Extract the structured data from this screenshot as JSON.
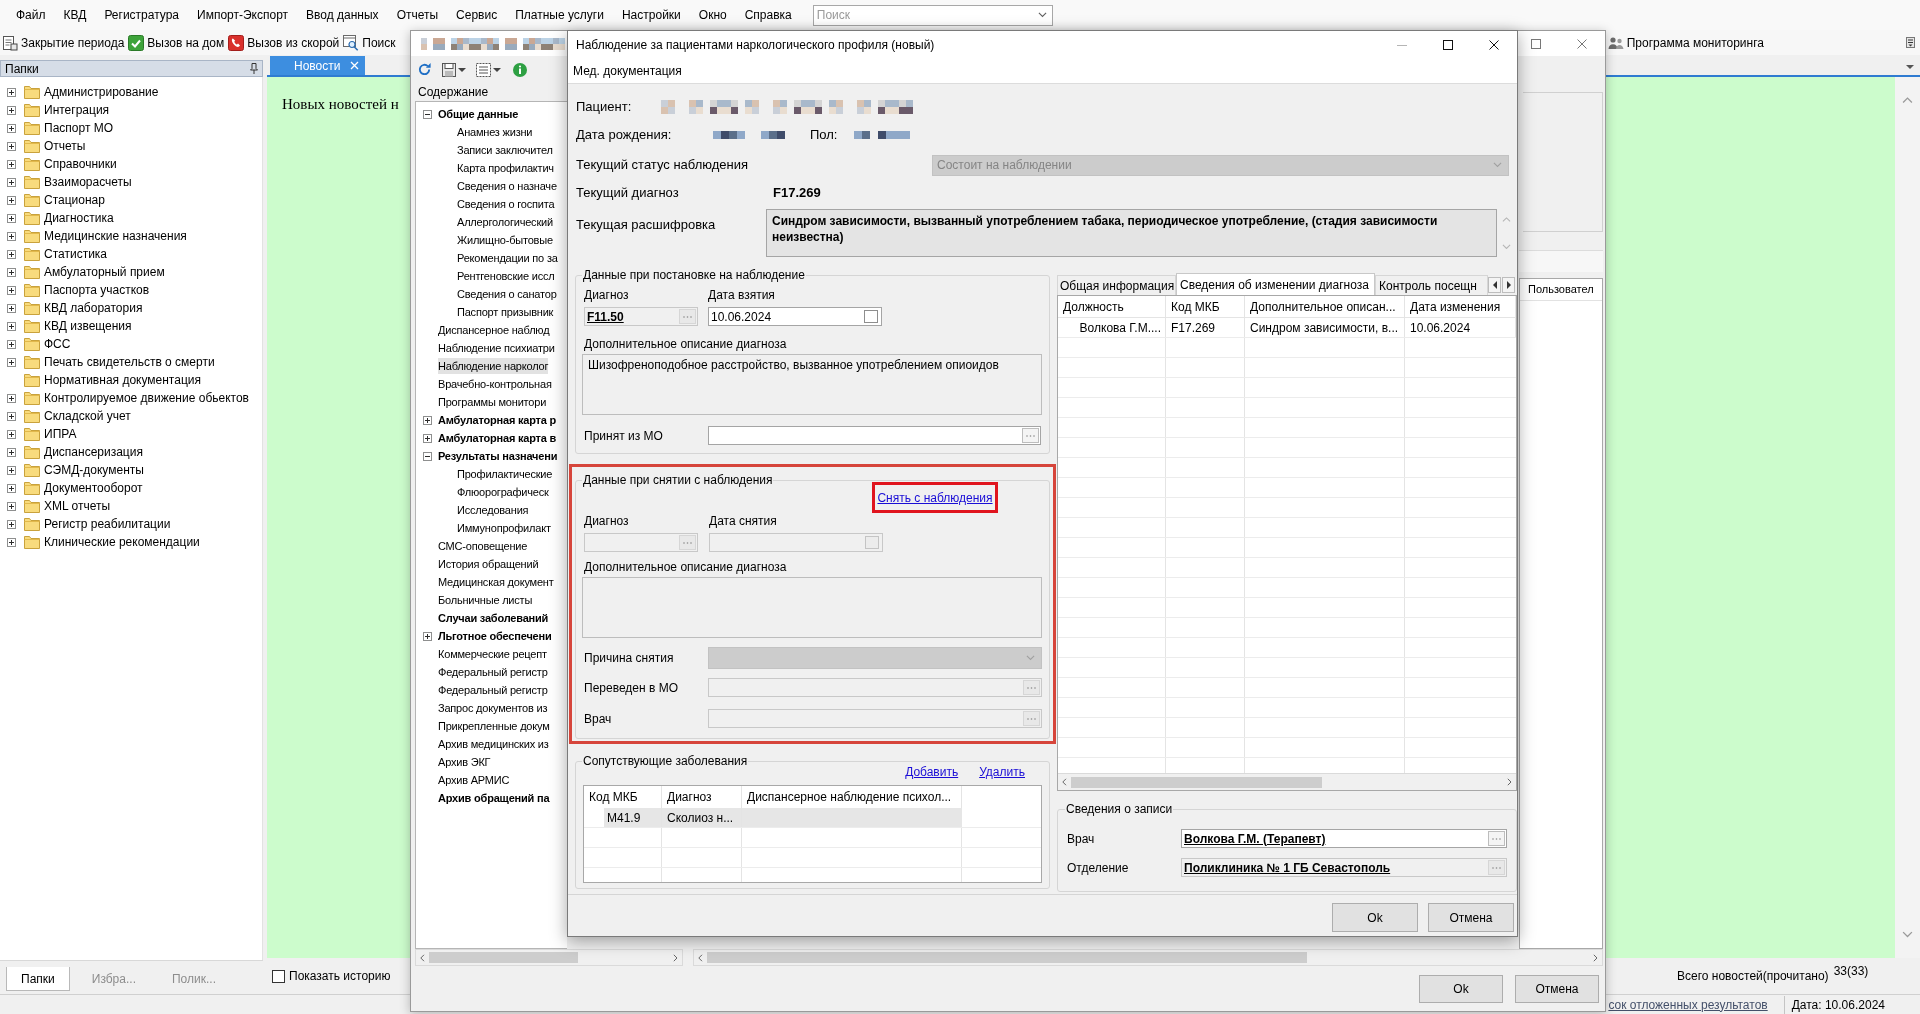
{
  "menu": [
    "Файл",
    "КВД",
    "Регистратура",
    "Импорт-Экспорт",
    "Ввод данных",
    "Отчеты",
    "Сервис",
    "Платные услуги",
    "Настройки",
    "Окно",
    "Справка"
  ],
  "search": {
    "placeholder": "Поиск"
  },
  "toolbar": [
    "Закрытие периода",
    "Вызов на дом",
    "Вызов из скорой",
    "Поиск"
  ],
  "toolbar_right": [
    "Программа мониторинга"
  ],
  "folders_panel": {
    "title": "Папки",
    "items": [
      {
        "label": "Администрирование",
        "expandable": true
      },
      {
        "label": "Интеграция",
        "expandable": true
      },
      {
        "label": "Паспорт МО",
        "expandable": true
      },
      {
        "label": "Отчеты",
        "expandable": true
      },
      {
        "label": "Справочники",
        "expandable": true
      },
      {
        "label": "Взаиморасчеты",
        "expandable": true
      },
      {
        "label": "Стационар",
        "expandable": true
      },
      {
        "label": "Диагностика",
        "expandable": true
      },
      {
        "label": "Медицинские назначения",
        "expandable": true
      },
      {
        "label": "Статистика",
        "expandable": true
      },
      {
        "label": "Амбулаторный прием",
        "expandable": true
      },
      {
        "label": "Паспорта участков",
        "expandable": true
      },
      {
        "label": "КВД лаборатория",
        "expandable": true
      },
      {
        "label": "КВД извещения",
        "expandable": true
      },
      {
        "label": "ФСС",
        "expandable": true
      },
      {
        "label": "Печать свидетельств о смерти",
        "expandable": true
      },
      {
        "label": "Нормативная документация",
        "expandable": false
      },
      {
        "label": "Контролируемое движение обьектов",
        "expandable": true
      },
      {
        "label": "Складской учет",
        "expandable": true
      },
      {
        "label": "ИПРА",
        "expandable": true
      },
      {
        "label": "Диспансеризация",
        "expandable": true
      },
      {
        "label": "СЭМД-документы",
        "expandable": true
      },
      {
        "label": "Документооборот",
        "expandable": true
      },
      {
        "label": "XML отчеты",
        "expandable": true
      },
      {
        "label": "Регистр реабилитации",
        "expandable": true
      },
      {
        "label": "Клинические рекомендации",
        "expandable": true
      }
    ],
    "tabs": [
      {
        "label": "Папки",
        "selected": true
      },
      {
        "label": "Избра...",
        "selected": false
      },
      {
        "label": "Полик...",
        "selected": false
      }
    ]
  },
  "news": {
    "tab": "Новости",
    "message": "Новых новостей н",
    "show_history": {
      "label": "Показать историю",
      "checked": false
    },
    "total_label": "Всего новостей(прочитано)",
    "total_count": "33(33)"
  },
  "status_bar": {
    "link": "сок отложенных результатов",
    "date": "Дата: 10.06.2024"
  },
  "document_window": {
    "contents_title": "Содержание",
    "tree": [
      {
        "label": "Общие данные",
        "bold": true,
        "expanded": true,
        "selected": false,
        "children": [
          {
            "label": "Анамнез жизни",
            "bold": false,
            "selected": false
          },
          {
            "label": "Записи заключител",
            "bold": false,
            "selected": false
          },
          {
            "label": "Карта профилактич",
            "bold": false,
            "selected": false
          },
          {
            "label": "Сведения о назначе",
            "bold": false,
            "selected": false
          },
          {
            "label": "Сведения о госпита",
            "bold": false,
            "selected": false
          },
          {
            "label": "Аллергологический",
            "bold": false,
            "selected": false
          },
          {
            "label": "Жилищно-бытовые",
            "bold": false,
            "selected": false
          },
          {
            "label": "Рекомендации по за",
            "bold": false,
            "selected": false
          },
          {
            "label": "Рентгеновские иссл",
            "bold": false,
            "selected": false
          },
          {
            "label": "Сведения о санатор",
            "bold": false,
            "selected": false
          },
          {
            "label": "Паспорт призывник",
            "bold": false,
            "selected": false
          }
        ]
      },
      {
        "label": "Диспансерное наблюд",
        "bold": false,
        "selected": false
      },
      {
        "label": "Наблюдение психиатри",
        "bold": false,
        "selected": false
      },
      {
        "label": "Наблюдение нарколог",
        "bold": false,
        "selected": true
      },
      {
        "label": "Врачебно-контрольная",
        "bold": false,
        "selected": false
      },
      {
        "label": "Программы монитори",
        "bold": false,
        "selected": false
      },
      {
        "label": "Амбулаторная карта р",
        "bold": true,
        "expanded": false,
        "selected": false
      },
      {
        "label": "Амбулаторная карта в",
        "bold": true,
        "expanded": false,
        "selected": false
      },
      {
        "label": "Результаты назначени",
        "bold": true,
        "expanded": true,
        "selected": false,
        "children": [
          {
            "label": "Профилактические",
            "bold": false,
            "selected": false
          },
          {
            "label": "Флюорографическ",
            "bold": false,
            "selected": false
          },
          {
            "label": "Исследования",
            "bold": false,
            "selected": false
          },
          {
            "label": "Иммунопрофилакт",
            "bold": false,
            "selected": false
          }
        ]
      },
      {
        "label": "СМС-оповещение",
        "bold": false,
        "selected": false
      },
      {
        "label": "История обращений",
        "bold": false,
        "selected": false
      },
      {
        "label": "Медицинская документ",
        "bold": false,
        "selected": false
      },
      {
        "label": "Больничные листы",
        "bold": false,
        "selected": false
      },
      {
        "label": "Случаи заболеваний",
        "bold": true,
        "selected": false
      },
      {
        "label": "Льготное обеспечени",
        "bold": true,
        "expanded": false,
        "selected": false
      },
      {
        "label": "Коммерческие рецепт",
        "bold": false,
        "selected": false
      },
      {
        "label": "Федеральный регистр",
        "bold": false,
        "selected": false
      },
      {
        "label": "Федеральный регистр",
        "bold": false,
        "selected": false
      },
      {
        "label": "Запрос документов из",
        "bold": false,
        "selected": false
      },
      {
        "label": "Прикрепленные докум",
        "bold": false,
        "selected": false
      },
      {
        "label": "Архив медицинских из",
        "bold": false,
        "selected": false
      },
      {
        "label": "Архив ЭКГ",
        "bold": false,
        "selected": false
      },
      {
        "label": "Архив АРМИС",
        "bold": false,
        "selected": false
      },
      {
        "label": "Архив обращений па",
        "bold": true,
        "selected": false
      }
    ],
    "grid_column": "Пользовател",
    "buttons": [
      "Ok",
      "Отмена"
    ]
  },
  "dialog": {
    "title": "Наблюдение за пациентами наркологического профиля (новый)",
    "menu": [
      "Мед. документация"
    ],
    "patient": {
      "label": "Пациент:"
    },
    "birth_date": {
      "label": "Дата рождения:"
    },
    "sex": {
      "label": "Пол:"
    },
    "status": {
      "label": "Текущий статус наблюдения",
      "value": "Состоит на наблюдении",
      "disabled": true
    },
    "current_diagnosis": {
      "label": "Текущий диагноз",
      "value": "F17.269"
    },
    "decoding": {
      "label": "Текущая расшифровка",
      "value": "Синдром зависимости, вызванный употреблением табака, периодическое употребление, (стадия зависимости неизвестна)"
    },
    "registration": {
      "title": "Данные при постановке на наблюдение",
      "diagnosis": {
        "label": "Диагноз",
        "value": "F11.50",
        "disabled": true
      },
      "date": {
        "label": "Дата взятия",
        "value": "10.06.2024",
        "disabled": false
      },
      "description": {
        "label": "Дополнительное описание диагноза",
        "value": "Шизофреноподобное расстройство, вызванное употреблением опиоидов"
      },
      "source_mo": {
        "label": "Принят из МО",
        "disabled": false
      }
    },
    "deregistration": {
      "title": "Данные при снятии с наблюдения",
      "highlighted": true,
      "action": {
        "label": "Снять с наблюдения",
        "highlighted": true
      },
      "diagnosis": {
        "label": "Диагноз",
        "disabled": true
      },
      "date": {
        "label": "Дата снятия",
        "disabled": true
      },
      "description": {
        "label": "Дополнительное описание диагноза"
      },
      "reason": {
        "label": "Причина снятия",
        "disabled": true
      },
      "transferred_mo": {
        "label": "Переведен в МО",
        "disabled": true
      },
      "doctor": {
        "label": "Врач",
        "disabled": true
      }
    },
    "comorbidities": {
      "title": "Сопутствующие заболевания",
      "actions": [
        "Добавить",
        "Удалить"
      ],
      "columns": [
        "Код МКБ",
        "Диагноз",
        "Диспансерное наблюдение психол..."
      ],
      "rows": [
        {
          "cells": [
            "M41.9",
            "Сколиоз н..."
          ],
          "selected": true
        }
      ]
    },
    "tabs": [
      {
        "label": "Общая информация",
        "selected": false
      },
      {
        "label": "Сведения об изменении диагноза",
        "selected": true
      },
      {
        "label": "Контроль посещн",
        "selected": false
      }
    ],
    "history": {
      "columns": [
        "Должность",
        "Код МКБ",
        "Дополнительное описан...",
        "Дата изменения"
      ],
      "rows": [
        [
          "Волкова Г.М....",
          "F17.269",
          "Синдром зависимости, в...",
          "10.06.2024"
        ]
      ]
    },
    "record": {
      "title": "Сведения о записи",
      "doctor": {
        "label": "Врач",
        "value": "Волкова Г.М. (Терапевт)",
        "disabled": false
      },
      "department": {
        "label": "Отделение",
        "value": "Поликлиника № 1 ГБ Севастополь",
        "disabled": true
      }
    },
    "buttons": [
      "Ok",
      "Отмена"
    ]
  }
}
